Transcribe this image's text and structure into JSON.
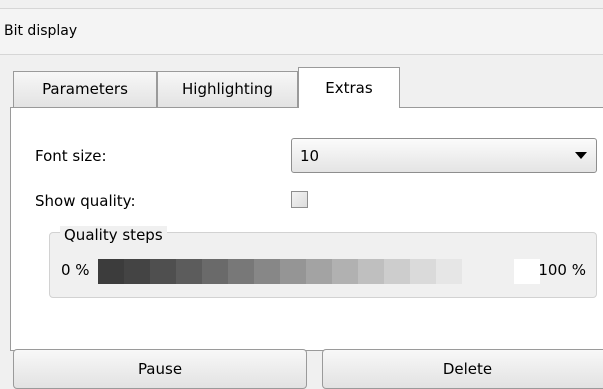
{
  "header": {
    "title": "Bit display"
  },
  "tabs": [
    {
      "label": "Parameters"
    },
    {
      "label": "Highlighting"
    },
    {
      "label": "Extras"
    }
  ],
  "active_tab": "Extras",
  "extras": {
    "font_size_label": "Font size:",
    "font_size_value": "10",
    "show_quality_label": "Show quality:",
    "show_quality_checked": false,
    "quality_group_title": "Quality steps",
    "quality_min_label": "0 %",
    "quality_max_label": "100 %",
    "quality_colors": [
      "#3c3c3c",
      "#444444",
      "#4f4f4f",
      "#5c5c5c",
      "#6a6a6a",
      "#787878",
      "#878787",
      "#959595",
      "#a3a3a3",
      "#b1b1b1",
      "#bfbfbf",
      "#cdcdcd",
      "#dadada",
      "#e6e6e6",
      "#f0f0f0",
      "#f0f0f0",
      "#ffffff"
    ]
  },
  "buttons": {
    "pause": "Pause",
    "delete": "Delete"
  }
}
